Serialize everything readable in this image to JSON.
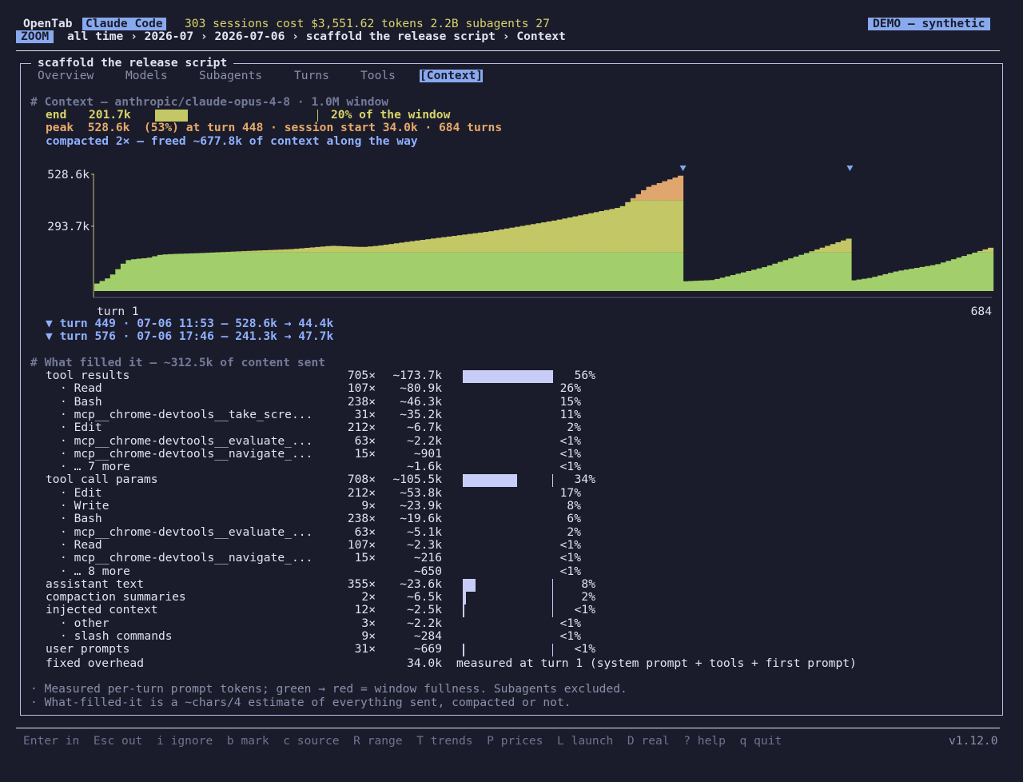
{
  "header": {
    "app_name": "OpenTab",
    "tab_active": "Claude Code",
    "stats": "303 sessions cost $3,551.62 tokens 2.2B subagents 27",
    "demo_badge": "DEMO — synthetic",
    "zoom_badge": "ZOOM",
    "breadcrumb": "all time › 2026-07 › 2026-07-06 › scaffold the release script › Context"
  },
  "panel": {
    "title": "scaffold the release script",
    "tabs": [
      {
        "label": "Overview",
        "active": false
      },
      {
        "label": "Models",
        "active": false
      },
      {
        "label": "Subagents",
        "active": false
      },
      {
        "label": "Turns",
        "active": false
      },
      {
        "label": "Tools",
        "active": false
      },
      {
        "label": "[Context]",
        "active": true
      }
    ]
  },
  "context": {
    "heading": "# Context — anthropic/claude-opus-4-8 · 1.0M window",
    "end_label": "end",
    "end_value": "201.7k",
    "end_fill": 0.2,
    "end_pct_text": "20% of the window",
    "peak_line": "peak  528.6k  (53%) at turn 448 · session start 34.0k · 684 turns",
    "compacted_line": "compacted 2× — freed ~677.8k of context along the way",
    "compaction_lines": [
      "▼ turn 449 · 07-06 11:53 — 528.6k → 44.4k",
      "▼ turn 576 · 07-06 17:46 — 241.3k → 47.7k"
    ]
  },
  "chart_data": {
    "type": "area",
    "title": "",
    "xlabel": "",
    "ylabel": "",
    "x_range": [
      1,
      684
    ],
    "x_start_label": "turn 1",
    "x_end_label": "684",
    "y_range": [
      0,
      528.6
    ],
    "y_ticks": [
      {
        "value": 528.6,
        "label": "528.6k"
      },
      {
        "value": 293.7,
        "label": "293.7k"
      }
    ],
    "compaction_turns": [
      449,
      576
    ],
    "points": [
      {
        "turn": 1,
        "k": 34
      },
      {
        "turn": 10,
        "k": 60
      },
      {
        "turn": 15,
        "k": 85
      },
      {
        "turn": 20,
        "k": 120
      },
      {
        "turn": 25,
        "k": 140
      },
      {
        "turn": 30,
        "k": 145
      },
      {
        "turn": 40,
        "k": 150
      },
      {
        "turn": 50,
        "k": 165
      },
      {
        "turn": 60,
        "k": 168
      },
      {
        "turn": 80,
        "k": 172
      },
      {
        "turn": 110,
        "k": 180
      },
      {
        "turn": 150,
        "k": 190
      },
      {
        "turn": 180,
        "k": 205
      },
      {
        "turn": 200,
        "k": 200
      },
      {
        "turn": 205,
        "k": 200
      },
      {
        "turn": 215,
        "k": 205
      },
      {
        "turn": 240,
        "k": 225
      },
      {
        "turn": 300,
        "k": 270
      },
      {
        "turn": 350,
        "k": 320
      },
      {
        "turn": 400,
        "k": 380
      },
      {
        "turn": 420,
        "k": 470
      },
      {
        "turn": 448,
        "k": 528.6
      },
      {
        "turn": 449,
        "k": 44.4
      },
      {
        "turn": 470,
        "k": 50
      },
      {
        "turn": 490,
        "k": 80
      },
      {
        "turn": 510,
        "k": 110
      },
      {
        "turn": 540,
        "k": 170
      },
      {
        "turn": 575,
        "k": 241.3
      },
      {
        "turn": 576,
        "k": 47.7
      },
      {
        "turn": 590,
        "k": 60
      },
      {
        "turn": 610,
        "k": 90
      },
      {
        "turn": 640,
        "k": 120
      },
      {
        "turn": 684,
        "k": 201.7
      }
    ],
    "band_thresholds_k": [
      176,
      412
    ],
    "colors": {
      "low": "#a2cf6b",
      "mid": "#c4c765",
      "high": "#dfa76d",
      "axis": "#c9c07a",
      "marker": "#7ea8ef"
    }
  },
  "filled": {
    "heading": "# What filled it — ~312.5k of content sent",
    "rows": [
      {
        "name": "tool results",
        "count": "705×",
        "tokens": "~173.7k",
        "pct": "56%",
        "fill": 0.56,
        "level": 0,
        "bar": true
      },
      {
        "name": "· Read",
        "count": "107×",
        "tokens": "~80.9k",
        "pct": "26%",
        "level": 1
      },
      {
        "name": "· Bash",
        "count": "238×",
        "tokens": "~46.3k",
        "pct": "15%",
        "level": 1
      },
      {
        "name": "· mcp__chrome-devtools__take_scre...",
        "count": "31×",
        "tokens": "~35.2k",
        "pct": "11%",
        "level": 1
      },
      {
        "name": "· Edit",
        "count": "212×",
        "tokens": "~6.7k",
        "pct": "2%",
        "level": 1
      },
      {
        "name": "· mcp__chrome-devtools__evaluate_...",
        "count": "63×",
        "tokens": "~2.2k",
        "pct": "<1%",
        "level": 1
      },
      {
        "name": "· mcp__chrome-devtools__navigate_...",
        "count": "15×",
        "tokens": "~901",
        "pct": "<1%",
        "level": 1
      },
      {
        "name": "· … 7 more",
        "count": "",
        "tokens": "~1.6k",
        "pct": "<1%",
        "level": 1
      },
      {
        "name": "tool call params",
        "count": "708×",
        "tokens": "~105.5k",
        "pct": "34%",
        "fill": 0.34,
        "level": 0,
        "bar": true
      },
      {
        "name": "· Edit",
        "count": "212×",
        "tokens": "~53.8k",
        "pct": "17%",
        "level": 1
      },
      {
        "name": "· Write",
        "count": "9×",
        "tokens": "~23.9k",
        "pct": "8%",
        "level": 1
      },
      {
        "name": "· Bash",
        "count": "238×",
        "tokens": "~19.6k",
        "pct": "6%",
        "level": 1
      },
      {
        "name": "· mcp__chrome-devtools__evaluate_...",
        "count": "63×",
        "tokens": "~5.1k",
        "pct": "2%",
        "level": 1
      },
      {
        "name": "· Read",
        "count": "107×",
        "tokens": "~2.3k",
        "pct": "<1%",
        "level": 1
      },
      {
        "name": "· mcp__chrome-devtools__navigate_...",
        "count": "15×",
        "tokens": "~216",
        "pct": "<1%",
        "level": 1
      },
      {
        "name": "· … 8 more",
        "count": "",
        "tokens": "~650",
        "pct": "<1%",
        "level": 1
      },
      {
        "name": "assistant text",
        "count": "355×",
        "tokens": "~23.6k",
        "pct": "8%",
        "fill": 0.08,
        "level": 0,
        "bar": true
      },
      {
        "name": "compaction summaries",
        "count": "2×",
        "tokens": "~6.5k",
        "pct": "2%",
        "fill": 0.02,
        "level": 0,
        "bar": true
      },
      {
        "name": "injected context",
        "count": "12×",
        "tokens": "~2.5k",
        "pct": "<1%",
        "fill": 0.008,
        "level": 0,
        "bar": true
      },
      {
        "name": "· other",
        "count": "3×",
        "tokens": "~2.2k",
        "pct": "<1%",
        "level": 1
      },
      {
        "name": "· slash commands",
        "count": "9×",
        "tokens": "~284",
        "pct": "<1%",
        "level": 1
      },
      {
        "name": "user prompts",
        "count": "31×",
        "tokens": "~669",
        "pct": "<1%",
        "fill": 0.002,
        "level": 0,
        "bar": true
      }
    ],
    "overhead_label": "fixed overhead",
    "overhead_value": "34.0k",
    "overhead_note": "measured at turn 1 (system prompt + tools + first prompt)"
  },
  "notes": [
    "· Measured per-turn prompt tokens; green → red = window fullness. Subagents excluded.",
    "· What-filled-it is a ~chars/4 estimate of everything sent, compacted or not."
  ],
  "footer": {
    "keys": [
      {
        "key": "Enter",
        "label": "in"
      },
      {
        "key": "Esc",
        "label": "out"
      },
      {
        "key": "i",
        "label": "ignore"
      },
      {
        "key": "b",
        "label": "mark"
      },
      {
        "key": "c",
        "label": "source"
      },
      {
        "key": "R",
        "label": "range"
      },
      {
        "key": "T",
        "label": "trends"
      },
      {
        "key": "P",
        "label": "prices"
      },
      {
        "key": "L",
        "label": "launch"
      },
      {
        "key": "D",
        "label": "real"
      },
      {
        "key": "?",
        "label": "help"
      },
      {
        "key": "q",
        "label": "quit"
      }
    ],
    "version": "v1.12.0"
  }
}
